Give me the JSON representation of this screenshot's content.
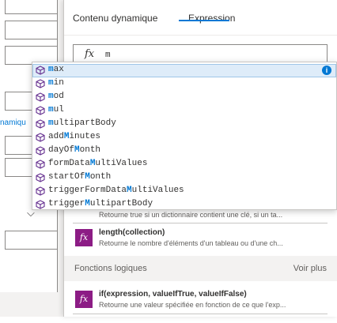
{
  "left_form": {
    "link_fragment": "namiqu"
  },
  "panel": {
    "tabs": [
      {
        "label": "Contenu dynamique",
        "active": false
      },
      {
        "label": "Expression",
        "active": true
      }
    ],
    "expression": {
      "fx_symbol": "fx",
      "value": "m"
    },
    "functions": [
      {
        "signature": "",
        "description": "Retourne true si un dictionnaire contient une clé, si un ta..."
      },
      {
        "signature": "length(collection)",
        "description": "Retourne le nombre d'éléments d'un tableau ou d'une ch..."
      },
      {
        "signature": "if(expression, valueIfTrue, valueIfFalse)",
        "description": "Retourne une valeur spécifiée en fonction de ce que l'exp..."
      }
    ],
    "section": {
      "title": "Fonctions logiques",
      "more_label": "Voir plus"
    }
  },
  "autocomplete": {
    "info_symbol": "i",
    "items": [
      {
        "before": "",
        "match": "m",
        "after": "ax"
      },
      {
        "before": "",
        "match": "m",
        "after": "in"
      },
      {
        "before": "",
        "match": "m",
        "after": "od"
      },
      {
        "before": "",
        "match": "m",
        "after": "ul"
      },
      {
        "before": "",
        "match": "m",
        "after": "ultipartBody"
      },
      {
        "before": "add",
        "match": "M",
        "after": "inutes"
      },
      {
        "before": "dayOf",
        "match": "M",
        "after": "onth"
      },
      {
        "before": "formData",
        "match": "M",
        "after": "ultiValues"
      },
      {
        "before": "startOf",
        "match": "M",
        "after": "onth"
      },
      {
        "before": "triggerFormData",
        "match": "M",
        "after": "ultiValues"
      },
      {
        "before": "trigger",
        "match": "M",
        "after": "ultipartBody"
      }
    ]
  },
  "colors": {
    "accent": "#0078d4",
    "function_icon_bg": "#8c1c85",
    "autocomplete_icon": "#652f8f",
    "selected_row_bg": "#deecf9"
  }
}
